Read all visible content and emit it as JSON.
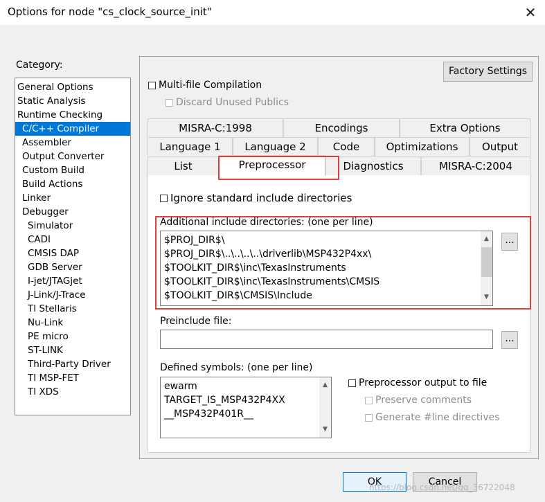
{
  "window": {
    "title": "Options for node \"cs_clock_source_init\""
  },
  "category": {
    "label": "Category:",
    "items": [
      {
        "label": "General Options",
        "level": 0
      },
      {
        "label": "Static Analysis",
        "level": 0
      },
      {
        "label": "Runtime Checking",
        "level": 0
      },
      {
        "label": "C/C++ Compiler",
        "level": 1,
        "selected": true
      },
      {
        "label": "Assembler",
        "level": 1
      },
      {
        "label": "Output Converter",
        "level": 1
      },
      {
        "label": "Custom Build",
        "level": 1
      },
      {
        "label": "Build Actions",
        "level": 1
      },
      {
        "label": "Linker",
        "level": 1
      },
      {
        "label": "Debugger",
        "level": 1
      },
      {
        "label": "Simulator",
        "level": 2
      },
      {
        "label": "CADI",
        "level": 2
      },
      {
        "label": "CMSIS DAP",
        "level": 2
      },
      {
        "label": "GDB Server",
        "level": 2
      },
      {
        "label": "I-jet/JTAGjet",
        "level": 2
      },
      {
        "label": "J-Link/J-Trace",
        "level": 2
      },
      {
        "label": "TI Stellaris",
        "level": 2
      },
      {
        "label": "Nu-Link",
        "level": 2
      },
      {
        "label": "PE micro",
        "level": 2
      },
      {
        "label": "ST-LINK",
        "level": 2
      },
      {
        "label": "Third-Party Driver",
        "level": 2
      },
      {
        "label": "TI MSP-FET",
        "level": 2
      },
      {
        "label": "TI XDS",
        "level": 2
      }
    ]
  },
  "panel": {
    "factory_settings": "Factory Settings",
    "multi_file": "Multi-file Compilation",
    "discard_unused": "Discard Unused Publics",
    "tabs": {
      "misra1998": "MISRA-C:1998",
      "encodings": "Encodings",
      "extra_options": "Extra Options",
      "language1": "Language 1",
      "language2": "Language 2",
      "code": "Code",
      "optimizations": "Optimizations",
      "output": "Output",
      "list": "List",
      "preprocessor": "Preprocessor",
      "diagnostics": "Diagnostics",
      "misra2004": "MISRA-C:2004"
    },
    "ignore_std_include": "Ignore standard include directories",
    "include_dirs_label": "Additional include directories: (one per line)",
    "include_dirs": [
      "$PROJ_DIR$\\",
      "$PROJ_DIR$\\..\\..\\..\\..\\driverlib\\MSP432P4xx\\",
      "$TOOLKIT_DIR$\\inc\\TexasInstruments",
      "$TOOLKIT_DIR$\\inc\\TexasInstruments\\CMSIS",
      "$TOOLKIT_DIR$\\CMSIS\\Include"
    ],
    "browse_label": "...",
    "preinclude_label": "Preinclude file:",
    "preinclude_value": "",
    "defined_symbols_label": "Defined symbols: (one per line)",
    "defined_symbols": [
      "ewarm",
      "TARGET_IS_MSP432P4XX",
      "__MSP432P401R__"
    ],
    "preprocessor_output": "Preprocessor output to file",
    "preserve_comments": "Preserve comments",
    "generate_line": "Generate #line directives"
  },
  "buttons": {
    "ok": "OK",
    "cancel": "Cancel"
  },
  "watermark": "https://blog.csdn.net/qq_36722048",
  "colors": {
    "selection": "#0078d7",
    "highlight_box": "#e03d3d"
  }
}
